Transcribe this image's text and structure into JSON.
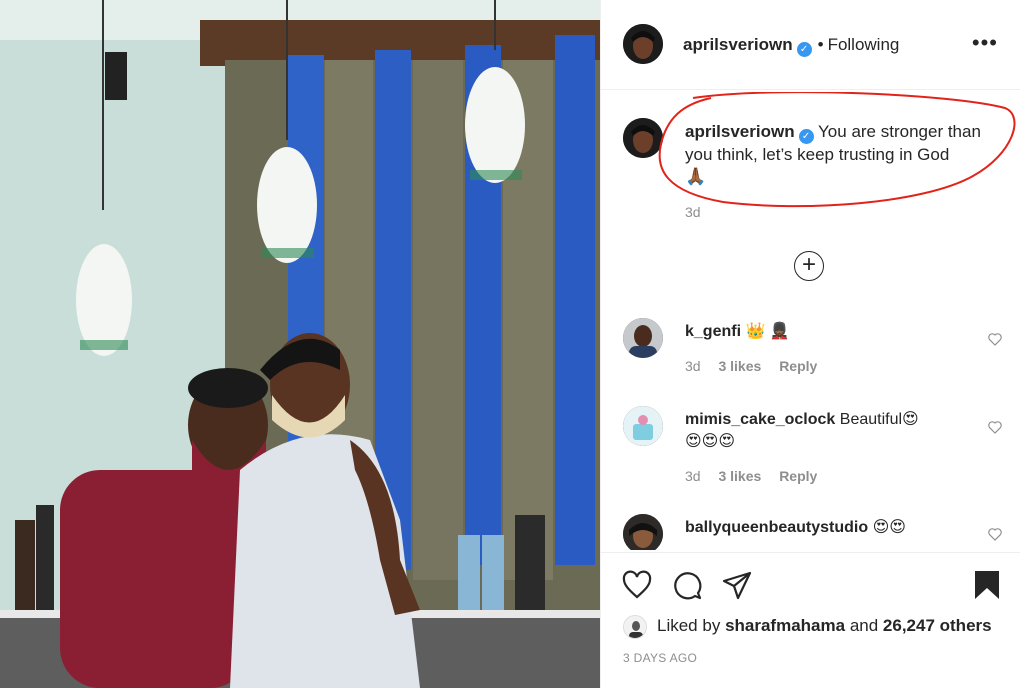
{
  "post": {
    "username": "aprilsveriown",
    "following": "Following",
    "caption": "You are stronger than you think, let’s keep trusting in God",
    "caption_emoji": "🙏🏾",
    "caption_time": "3d",
    "more": "•••",
    "load_more": "+"
  },
  "comments": [
    {
      "username": "k_genfi",
      "text": "",
      "emoji": "👑 💂🏾",
      "time": "3d",
      "likes": "3 likes",
      "reply": "Reply"
    },
    {
      "username": "mimis_cake_oclock",
      "text": "Beautiful",
      "emoji": "😍",
      "emoji2": "😍😍😍",
      "time": "3d",
      "likes": "3 likes",
      "reply": "Reply"
    },
    {
      "username": "ballyqueenbeautystudio",
      "text": "",
      "emoji": "😍😍"
    }
  ],
  "footer": {
    "liked_prefix": "Liked by",
    "liked_user": "sharafmahama",
    "liked_and": "and",
    "liked_others": "26,247 others",
    "posted_ago": "3 DAYS AGO"
  },
  "colors": {
    "verified": "#3897f0",
    "annotation": "#e2231a",
    "muted_text": "#8e8e8e",
    "text": "#262626"
  },
  "icons": [
    "verified-icon",
    "more-options-icon",
    "add-circle-icon",
    "heart-icon",
    "comment-icon",
    "share-icon",
    "bookmark-icon"
  ]
}
